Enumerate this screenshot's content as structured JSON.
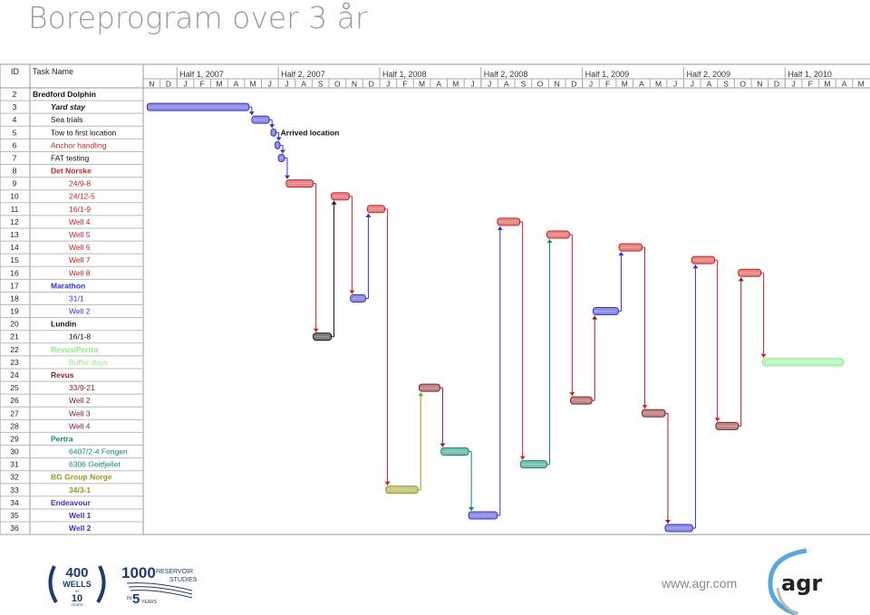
{
  "title": "Boreprogram over 3 år",
  "chart_data": {
    "type": "gantt",
    "columns": {
      "id": "ID",
      "name": "Task Name"
    },
    "timescale": {
      "halves": [
        "Half 1, 2007",
        "Half 2, 2007",
        "Half 1, 2008",
        "Half 2, 2008",
        "Half 1, 2009",
        "Half 2, 2009",
        "Half 1, 2010"
      ],
      "months": [
        "N",
        "D",
        "J",
        "F",
        "M",
        "A",
        "M",
        "J",
        "J",
        "A",
        "S",
        "O",
        "N",
        "D",
        "J",
        "F",
        "M",
        "A",
        "M",
        "J",
        "J",
        "A",
        "S",
        "O",
        "N",
        "D",
        "J",
        "F",
        "M",
        "A",
        "M",
        "J",
        "J",
        "A",
        "S",
        "O",
        "N",
        "D",
        "J",
        "F",
        "M",
        "A",
        "M"
      ],
      "range": [
        "2006-11-01",
        "2010-06-01"
      ]
    },
    "colors": {
      "blue": "#3333cc",
      "red": "#cc2222",
      "black": "#111111",
      "green": "#88ee88",
      "darkred": "#882222",
      "teal": "#118877",
      "olive": "#999922"
    },
    "tasks": [
      {
        "id": "2",
        "name": "Bredford Dolphin",
        "level": 1,
        "color": "black",
        "bold": true
      },
      {
        "id": "3",
        "name": "Yard stay",
        "level": 2,
        "color": "black",
        "bold": true,
        "italic": true,
        "start": "2006-11-08",
        "end": "2007-05-09",
        "bar": "blue"
      },
      {
        "id": "4",
        "name": "Sea trials",
        "level": 2,
        "color": "black",
        "start": "2007-05-14",
        "end": "2007-06-15",
        "bar": "blue"
      },
      {
        "id": "5",
        "name": "Tow to first location",
        "level": 2,
        "color": "black",
        "start": "2007-06-18",
        "end": "2007-06-27",
        "bar": "blue",
        "label": "Arrived location"
      },
      {
        "id": "6",
        "name": "Anchor handling",
        "level": 2,
        "color": "red",
        "start": "2007-06-25",
        "end": "2007-07-04",
        "bar": "blue"
      },
      {
        "id": "7",
        "name": "FAT testing",
        "level": 2,
        "color": "black",
        "start": "2007-07-01",
        "end": "2007-07-12",
        "bar": "blue"
      },
      {
        "id": "8",
        "name": "Det Norske",
        "level": 1,
        "color": "red",
        "bold": true
      },
      {
        "id": "9",
        "name": "24/9-8",
        "level": 3,
        "color": "red",
        "start": "2007-07-15",
        "end": "2007-09-03",
        "bar": "red"
      },
      {
        "id": "10",
        "name": "24/12-5",
        "level": 3,
        "color": "red",
        "start": "2007-10-05",
        "end": "2007-11-07",
        "bar": "red"
      },
      {
        "id": "11",
        "name": "16/1-9",
        "level": 3,
        "color": "red",
        "start": "2007-12-09",
        "end": "2008-01-10",
        "bar": "red"
      },
      {
        "id": "12",
        "name": "Well 4",
        "level": 3,
        "color": "red",
        "start": "2008-07-30",
        "end": "2008-09-10",
        "bar": "red"
      },
      {
        "id": "13",
        "name": "Well 5",
        "level": 3,
        "color": "red",
        "start": "2008-10-28",
        "end": "2008-12-08",
        "bar": "red"
      },
      {
        "id": "14",
        "name": "Well 6",
        "level": 3,
        "color": "red",
        "start": "2009-03-06",
        "end": "2009-04-17",
        "bar": "red"
      },
      {
        "id": "15",
        "name": "Well 7",
        "level": 3,
        "color": "red",
        "start": "2009-07-15",
        "end": "2009-08-26",
        "bar": "red"
      },
      {
        "id": "16",
        "name": "Well 8",
        "level": 3,
        "color": "red",
        "start": "2009-10-08",
        "end": "2009-11-18",
        "bar": "red"
      },
      {
        "id": "17",
        "name": "Marathon",
        "level": 1,
        "color": "blue",
        "bold": true
      },
      {
        "id": "18",
        "name": "31/1",
        "level": 3,
        "color": "blue",
        "start": "2007-11-09",
        "end": "2007-12-06",
        "bar": "blue"
      },
      {
        "id": "19",
        "name": "Well 2",
        "level": 3,
        "color": "blue",
        "start": "2009-01-20",
        "end": "2009-03-05",
        "bar": "blue"
      },
      {
        "id": "20",
        "name": "Lundin",
        "level": 1,
        "color": "black",
        "bold": true
      },
      {
        "id": "21",
        "name": "16/1-8",
        "level": 3,
        "color": "black",
        "start": "2007-09-03",
        "end": "2007-10-05",
        "bar": "black"
      },
      {
        "id": "22",
        "name": "Revus/Pertra",
        "level": 1,
        "color": "green",
        "bold": true
      },
      {
        "id": "23",
        "name": "Buffer days",
        "level": 3,
        "color": "green",
        "start": "2009-11-21",
        "end": "2010-04-15",
        "bar": "green"
      },
      {
        "id": "24",
        "name": "Revus",
        "level": 1,
        "color": "darkred",
        "bold": true
      },
      {
        "id": "25",
        "name": "33/9-21",
        "level": 3,
        "color": "darkred",
        "start": "2008-03-11",
        "end": "2008-04-18",
        "bar": "darkred"
      },
      {
        "id": "26",
        "name": "Well 2",
        "level": 3,
        "color": "darkred",
        "start": "2008-12-10",
        "end": "2009-01-18",
        "bar": "darkred"
      },
      {
        "id": "27",
        "name": "Well 3",
        "level": 3,
        "color": "darkred",
        "start": "2009-04-17",
        "end": "2009-05-28",
        "bar": "darkred"
      },
      {
        "id": "28",
        "name": "Well 4",
        "level": 3,
        "color": "darkred",
        "start": "2009-08-28",
        "end": "2009-10-08",
        "bar": "darkred"
      },
      {
        "id": "29",
        "name": "Pertra",
        "level": 1,
        "color": "teal",
        "bold": true
      },
      {
        "id": "30",
        "name": "6407/2-4 Fongen",
        "level": 3,
        "color": "teal",
        "start": "2008-04-20",
        "end": "2008-06-09",
        "bar": "teal"
      },
      {
        "id": "31",
        "name": "6306 Geitfjellet",
        "level": 3,
        "color": "teal",
        "start": "2008-09-11",
        "end": "2008-10-28",
        "bar": "teal"
      },
      {
        "id": "32",
        "name": "BG Group Norge",
        "level": 1,
        "color": "olive",
        "bold": true
      },
      {
        "id": "33",
        "name": "34/3-1",
        "level": 3,
        "color": "olive",
        "bold": true,
        "start": "2008-01-12",
        "end": "2008-03-09",
        "bar": "olive"
      },
      {
        "id": "34",
        "name": "Endeavour",
        "level": 1,
        "color": "blue",
        "bold": true
      },
      {
        "id": "35",
        "name": "Well 1",
        "level": 3,
        "color": "blue",
        "bold": true,
        "start": "2008-06-09",
        "end": "2008-07-30",
        "bar": "blue"
      },
      {
        "id": "36",
        "name": "Well 2",
        "level": 3,
        "color": "blue",
        "bold": true,
        "start": "2009-05-28",
        "end": "2009-07-17",
        "bar": "blue"
      }
    ],
    "links": [
      [
        "3",
        "4"
      ],
      [
        "4",
        "5"
      ],
      [
        "5",
        "6"
      ],
      [
        "6",
        "7"
      ],
      [
        "7",
        "9"
      ],
      [
        "9",
        "21"
      ],
      [
        "21",
        "10"
      ],
      [
        "10",
        "18"
      ],
      [
        "18",
        "11"
      ],
      [
        "11",
        "33"
      ],
      [
        "33",
        "25"
      ],
      [
        "25",
        "30"
      ],
      [
        "30",
        "35"
      ],
      [
        "35",
        "12"
      ],
      [
        "12",
        "31"
      ],
      [
        "31",
        "13"
      ],
      [
        "13",
        "26"
      ],
      [
        "26",
        "19"
      ],
      [
        "19",
        "14"
      ],
      [
        "14",
        "27"
      ],
      [
        "27",
        "36"
      ],
      [
        "36",
        "15"
      ],
      [
        "15",
        "28"
      ],
      [
        "28",
        "16"
      ],
      [
        "16",
        "23"
      ]
    ]
  },
  "footer": {
    "logo1": {
      "big": "400",
      "mid": "WELLS",
      "small": "IN",
      "num": "10",
      "unit": "YEARS"
    },
    "logo2": {
      "big": "1000",
      "l1": "RESERVOIR",
      "l2": "STUDIES",
      "small": "IN",
      "num": "5",
      "unit": "YEARS"
    },
    "url": "www.agr.com",
    "brand": "agr"
  }
}
